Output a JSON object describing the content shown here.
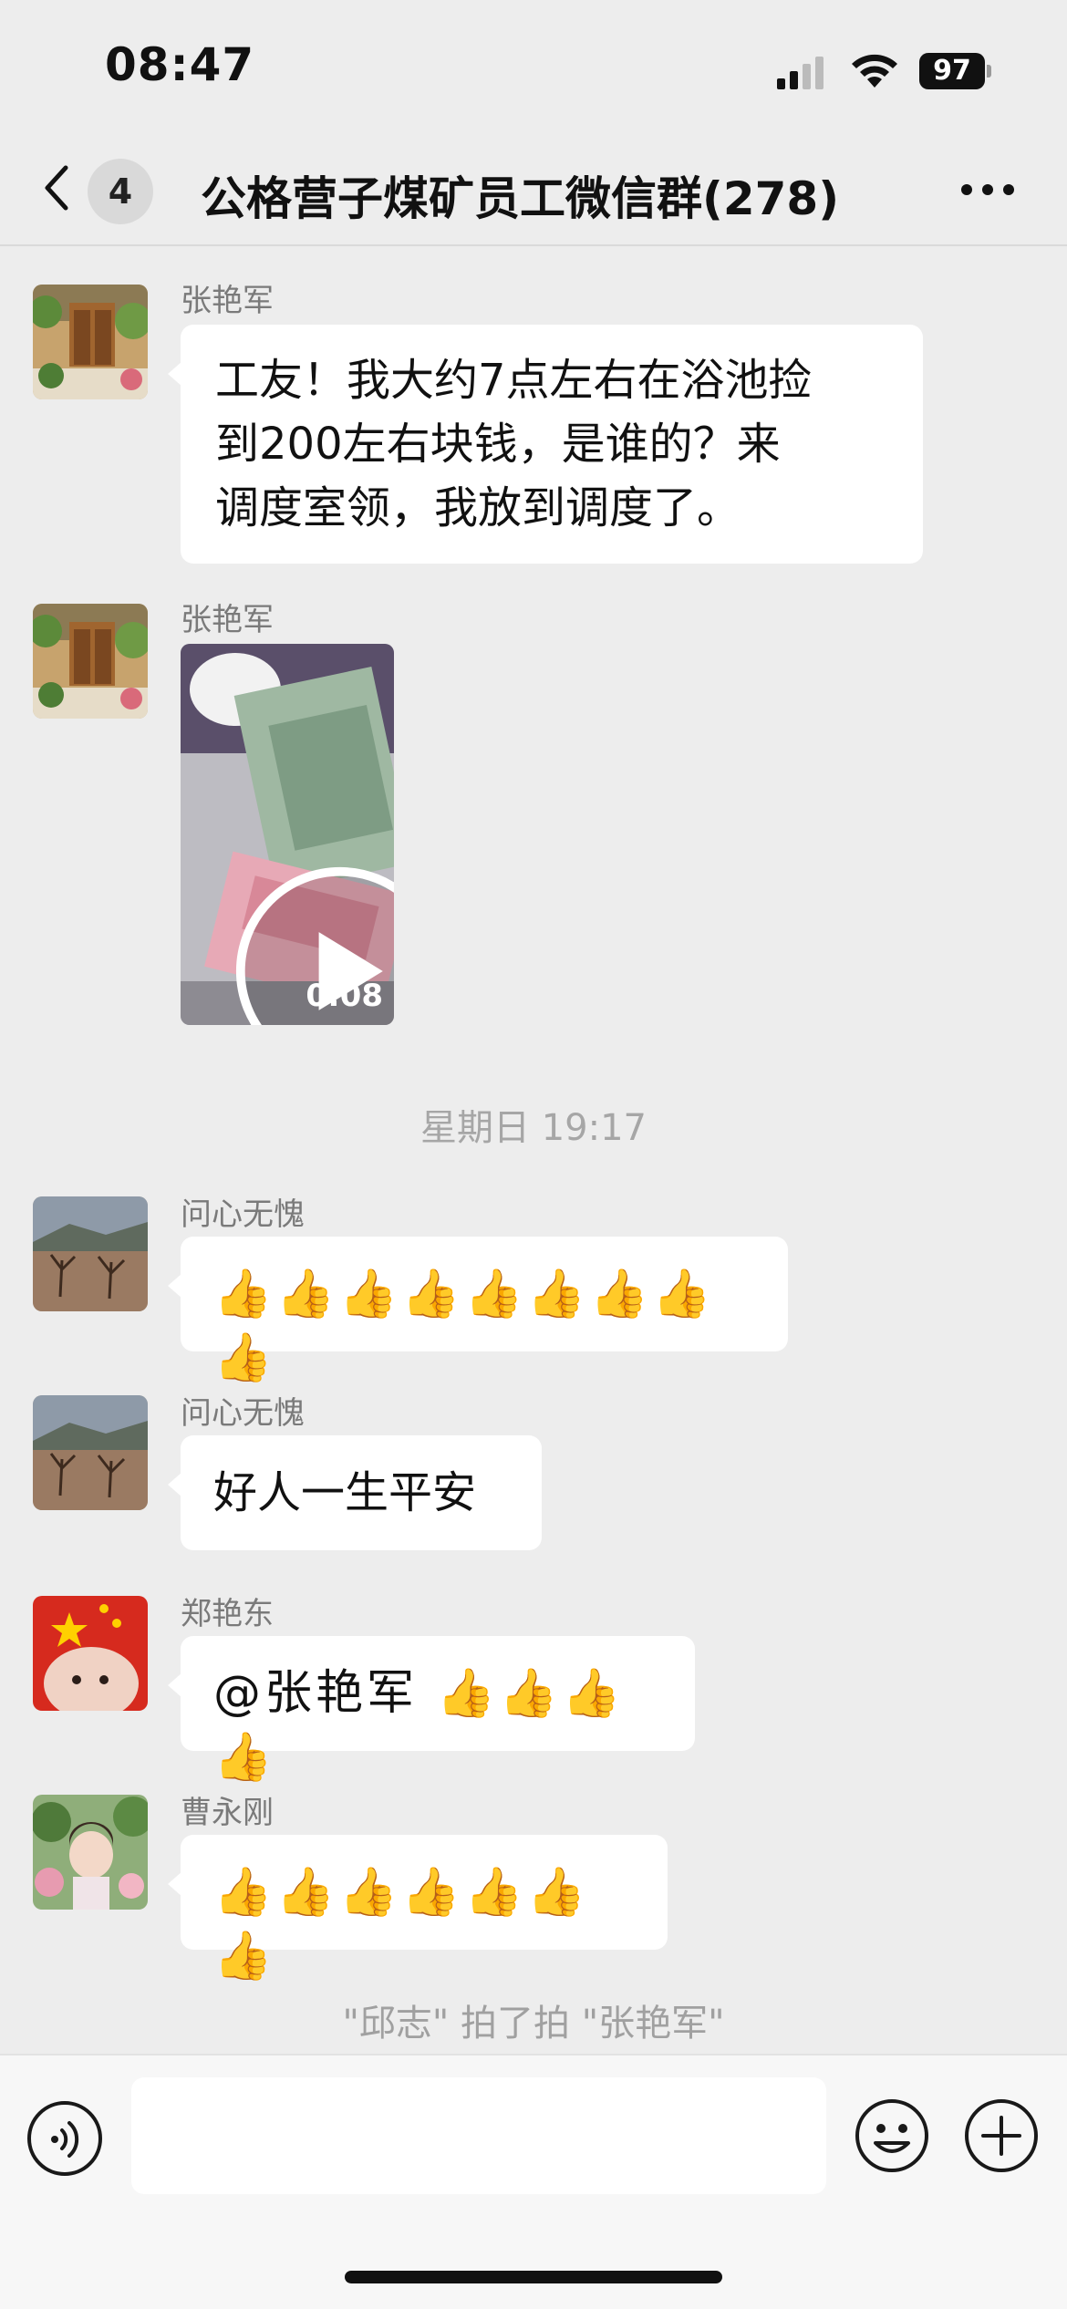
{
  "status_bar": {
    "time": "08:47",
    "battery": "97"
  },
  "nav": {
    "back_count": "4",
    "title": "公格营子煤矿员工微信群(278)"
  },
  "messages": [
    {
      "sender": "张艳军",
      "text_lines": [
        "工友！我大约7点左右在浴池捡",
        "到200左右块钱，是谁的？来",
        "调度室领，我放到调度了。"
      ]
    },
    {
      "sender": "张艳军",
      "video_duration": "0:08"
    },
    {
      "sender": "问心无愧",
      "text": "👍👍👍👍👍👍👍👍👍"
    },
    {
      "sender": "问心无愧",
      "text": "好人一生平安"
    },
    {
      "sender": "郑艳东",
      "text": "@张艳军 👍👍👍👍"
    },
    {
      "sender": "曹永刚",
      "text": "👍👍👍👍👍👍👍"
    }
  ],
  "timestamp": "星期日 19:17",
  "system_message": "\"邱志\" 拍了拍 \"张艳军\"",
  "input": {
    "placeholder": ""
  },
  "colors": {
    "background": "#ededed",
    "bubble": "#ffffff",
    "sender_name": "#7a7a7a"
  }
}
